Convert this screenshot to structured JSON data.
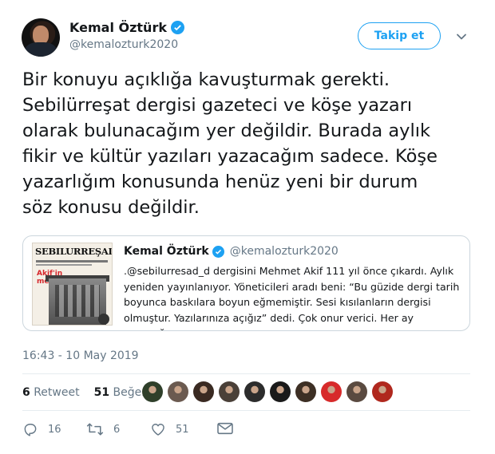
{
  "author": {
    "name": "Kemal Öztürk",
    "handle": "@kemalozturk2020"
  },
  "follow_button": {
    "label": "Takip et"
  },
  "tweet": {
    "lines": [
      "Bir konuyu açıklığa kavuşturmak gerekti.",
      "Sebilürreşat dergisi gazeteci ve köşe yazarı",
      "olarak bulunacağım yer değildir. Burada aylık",
      "fikir ve kültür yazıları yazacağım sadece. Köşe",
      "yazarlığım konusunda henüz yeni bir durum",
      "söz konusu değildir."
    ]
  },
  "quoted": {
    "magazine": {
      "masthead": "SEBILURREŞAD",
      "headline_1": "Akif'in",
      "headline_2": "mektebi"
    },
    "name": "Kemal Öztürk",
    "handle": "@kemalozturk2020",
    "lines": [
      ".@sebilurresad_d dergisini Mehmet Akif 111 yıl önce çıkardı. Aylık",
      "yeniden yayınlanıyor. Yöneticileri aradı beni: “Bu güzide dergi tarih",
      "boyunca  baskılara boyun eğmemiştir. Sesi kısılanların dergisi",
      "olmuştur. Yazılarınıza açığız” dedi. Çok onur verici. Her ay yazacağım."
    ]
  },
  "timestamp": "16:43 - 10 May 2019",
  "stats": {
    "retweets_count": "6",
    "retweets_label": "Retweet",
    "likes_count": "51",
    "likes_label": "Beğeni"
  },
  "likers": [
    "#2f3f2a",
    "#6b5a50",
    "#3a2a22",
    "#4a4038",
    "#2c2c2c",
    "#1a1a1a",
    "#3d2f24",
    "#d72a2a",
    "#5a4a40",
    "#b0281e"
  ],
  "actions": {
    "reply_count": "16",
    "retweet_count": "6",
    "like_count": "51"
  },
  "colors": {
    "accent": "#1da1f2",
    "muted": "#657786",
    "text": "#14171a",
    "border": "#ccd6dd"
  },
  "icons": [
    "verified-badge-icon",
    "chevron-down-icon",
    "reply-icon",
    "retweet-icon",
    "like-icon",
    "mail-icon"
  ]
}
